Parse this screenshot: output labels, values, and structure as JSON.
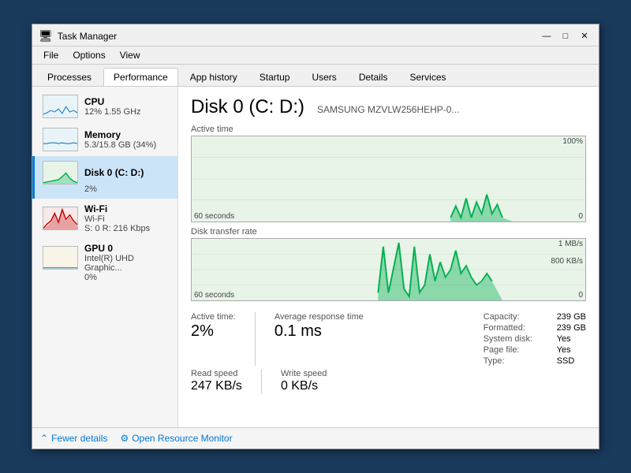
{
  "window": {
    "title": "Task Manager",
    "icon": "⚙"
  },
  "title_controls": {
    "minimize": "—",
    "maximize": "□",
    "close": "✕"
  },
  "menu": {
    "items": [
      "File",
      "Options",
      "View"
    ]
  },
  "tabs": {
    "items": [
      "Processes",
      "Performance",
      "App history",
      "Startup",
      "Users",
      "Details",
      "Services"
    ],
    "active": "Performance"
  },
  "sidebar": {
    "items": [
      {
        "id": "cpu",
        "label": "CPU",
        "sub": "12% 1.55 GHz",
        "pct": "",
        "active": false
      },
      {
        "id": "memory",
        "label": "Memory",
        "sub": "5.3/15.8 GB (34%)",
        "pct": "",
        "active": false
      },
      {
        "id": "disk0",
        "label": "Disk 0 (C: D:)",
        "sub": "",
        "pct": "2%",
        "active": true
      },
      {
        "id": "wifi",
        "label": "Wi-Fi",
        "sub": "Wi-Fi",
        "sub2": "S: 0  R: 216 Kbps",
        "pct": "",
        "active": false
      },
      {
        "id": "gpu0",
        "label": "GPU 0",
        "sub": "Intel(R) UHD Graphic...",
        "pct": "0%",
        "active": false
      }
    ]
  },
  "detail": {
    "title": "Disk 0 (C: D:)",
    "model": "SAMSUNG MZVLW256HEHP-0...",
    "chart_active": {
      "label": "Active time",
      "max_label": "100%",
      "min_label": "0",
      "time_label": "60 seconds"
    },
    "chart_transfer": {
      "label": "Disk transfer rate",
      "max_label": "1 MB/s",
      "mid_label": "800 KB/s",
      "min_label": "0",
      "time_label": "60 seconds"
    },
    "stats": {
      "active_time_label": "Active time:",
      "active_time_value": "2%",
      "avg_response_label": "Average response time",
      "avg_response_value": "0.1 ms",
      "read_speed_label": "Read speed",
      "read_speed_value": "247 KB/s",
      "write_speed_label": "Write speed",
      "write_speed_value": "0 KB/s",
      "capacity_label": "Capacity:",
      "capacity_value": "239 GB",
      "formatted_label": "Formatted:",
      "formatted_value": "239 GB",
      "system_disk_label": "System disk:",
      "system_disk_value": "Yes",
      "page_file_label": "Page file:",
      "page_file_value": "Yes",
      "type_label": "Type:",
      "type_value": "SSD"
    }
  },
  "footer": {
    "fewer_details": "Fewer details",
    "open_monitor": "Open Resource Monitor"
  }
}
